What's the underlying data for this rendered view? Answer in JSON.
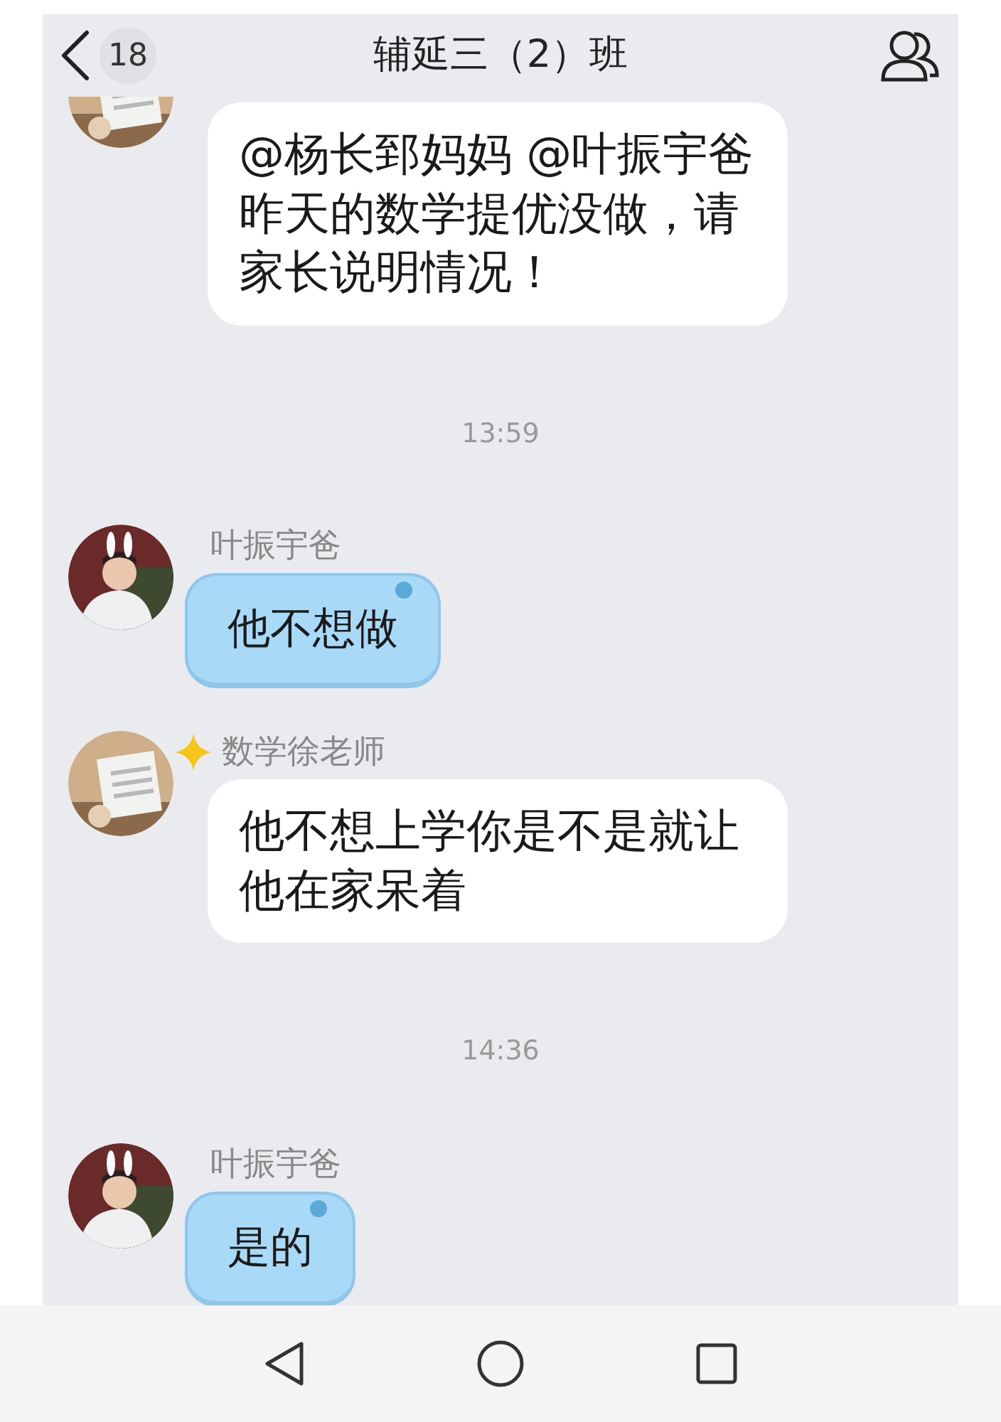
{
  "header": {
    "back_badge": "18",
    "title": "辅延三（2）班"
  },
  "messages": [
    {
      "kind": "plain_message",
      "badge": false,
      "text": "@杨长郅妈妈 @叶振宇爸昨天的数学提优没做，请家长说明情况！"
    },
    {
      "kind": "time",
      "text": "13:59"
    },
    {
      "kind": "themed_message",
      "sender": "叶振宇爸",
      "badge": false,
      "text": "他不想做"
    },
    {
      "kind": "plain_message",
      "sender": "数学徐老师",
      "badge": true,
      "text": "他不想上学你是不是就让他在家呆着"
    },
    {
      "kind": "time",
      "text": "14:36"
    },
    {
      "kind": "themed_message",
      "sender": "叶振宇爸",
      "badge": false,
      "text": "是的"
    }
  ]
}
